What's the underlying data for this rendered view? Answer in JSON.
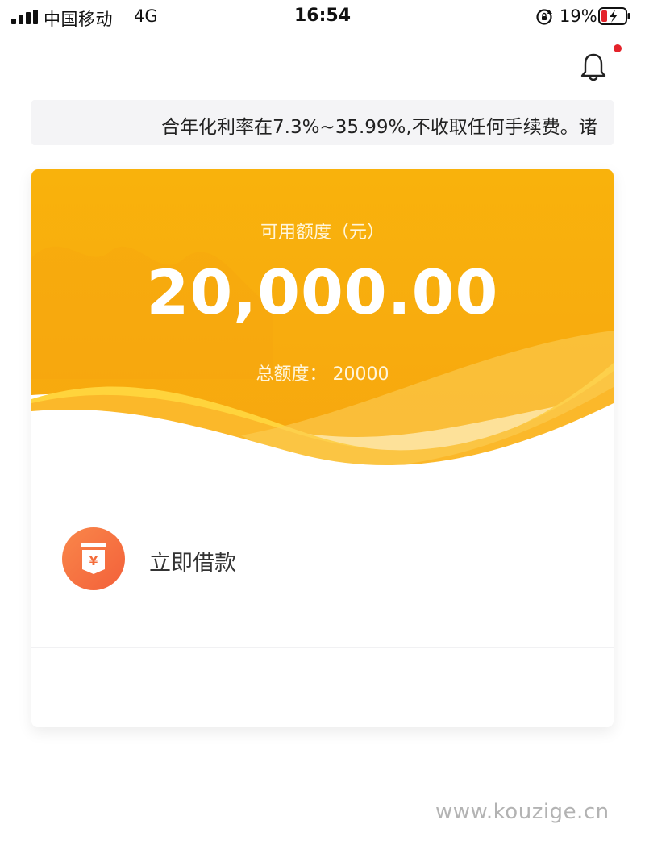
{
  "status_bar": {
    "carrier": "中国移动",
    "network": "4G",
    "time": "16:54",
    "battery_percent": "19%"
  },
  "notice": {
    "text": "合年化利率在7.3%~35.99%,不收取任何手续费。诸"
  },
  "credit_card": {
    "available_label": "可用额度（元）",
    "available_amount": "20,000.00",
    "total_label": "总额度：",
    "total_value": "20000"
  },
  "actions": {
    "borrow_label": "立即借款"
  },
  "watermark": "www.kouzige.cn",
  "colors": {
    "accent_orange": "#f8ac0e",
    "accent_yellow": "#ffd43c",
    "icon_orange": "#f46c3a",
    "notification_dot": "#e4232b"
  },
  "icons": [
    "signal-icon",
    "rotation-lock-icon",
    "battery-charging-icon",
    "bell-icon",
    "loan-icon"
  ]
}
